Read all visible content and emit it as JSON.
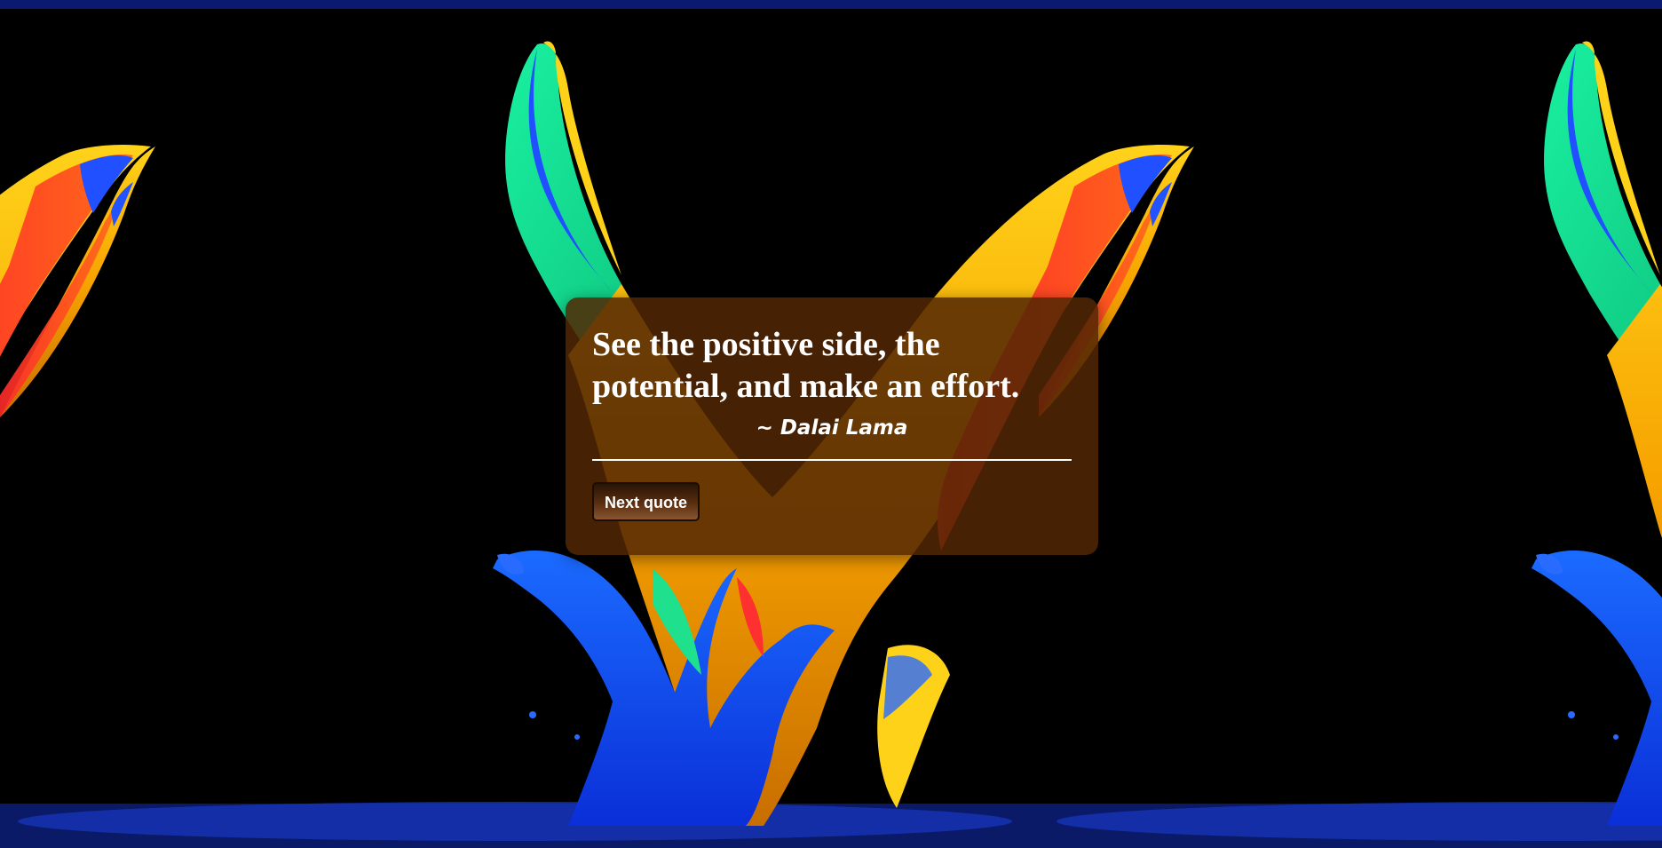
{
  "quote": {
    "text": "See the positive side, the potential, and make an effort.",
    "author": "~ Dalai Lama"
  },
  "controls": {
    "next_label": "Next quote"
  },
  "colors": {
    "page_background": "#000000",
    "card_background": "#522604",
    "text": "#ffffff",
    "button_gradient_top": "#2a1405",
    "button_gradient_bottom": "#8a5530"
  },
  "background": {
    "description_icon": "paint-splash-image"
  }
}
